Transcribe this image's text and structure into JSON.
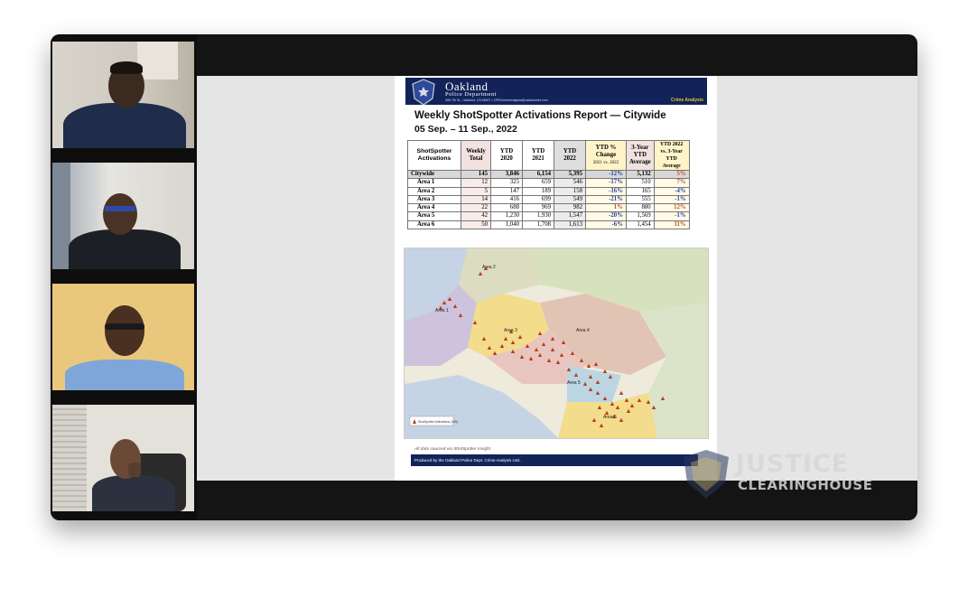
{
  "document": {
    "department_line1": "Oakland",
    "department_line2": "Police Department",
    "address": "455 7th St., Oakland, CA 94607 • OPDCrimeAnalysis@oaklandnet.com",
    "unit_tag": "Crime Analysis",
    "title": "Weekly ShotSpotter Activations Report — Citywide",
    "date_range": "05 Sep. – 11 Sep., 2022",
    "table": {
      "headers": [
        "ShotSpotter Activations",
        "Weekly Total",
        "YTD 2020",
        "YTD 2021",
        "YTD 2022",
        "YTD % Change",
        "3-Year YTD Average",
        "YTD 2022 vs. 3-Year YTD Average"
      ],
      "change_sub": "2021 vs. 2022",
      "rows": [
        {
          "label": "Citywide",
          "weekly": "145",
          "ytd2020": "3,846",
          "ytd2021": "6,154",
          "ytd2022": "5,395",
          "change": "-12%",
          "avg": "5,132",
          "vs": "5%"
        },
        {
          "label": "Area 1",
          "weekly": "12",
          "ytd2020": "325",
          "ytd2021": "659",
          "ytd2022": "546",
          "change": "-17%",
          "avg": "510",
          "vs": "7%"
        },
        {
          "label": "Area 2",
          "weekly": "5",
          "ytd2020": "147",
          "ytd2021": "189",
          "ytd2022": "158",
          "change": "-16%",
          "avg": "165",
          "vs": "-4%"
        },
        {
          "label": "Area 3",
          "weekly": "14",
          "ytd2020": "416",
          "ytd2021": "699",
          "ytd2022": "549",
          "change": "-21%",
          "avg": "555",
          "vs": "-1%"
        },
        {
          "label": "Area 4",
          "weekly": "22",
          "ytd2020": "688",
          "ytd2021": "969",
          "ytd2022": "982",
          "change": "1%",
          "avg": "880",
          "vs": "12%"
        },
        {
          "label": "Area 5",
          "weekly": "42",
          "ytd2020": "1,230",
          "ytd2021": "1,930",
          "ytd2022": "1,547",
          "change": "-20%",
          "avg": "1,569",
          "vs": "-1%"
        },
        {
          "label": "Area 6",
          "weekly": "50",
          "ytd2020": "1,040",
          "ytd2021": "1,708",
          "ytd2022": "1,613",
          "change": "-6%",
          "avg": "1,454",
          "vs": "11%"
        }
      ]
    },
    "map": {
      "area_labels": [
        "Area 1",
        "Area 2",
        "Area 3",
        "Area 4",
        "Area 5",
        "Area 6"
      ],
      "legend": "ShotSpotter Activations (145)"
    },
    "source_note": "All data sourced via ShotSpotter Insight",
    "footer": "Produced by the Oakland Police Dept. Crime Analysis Unit."
  },
  "watermark": {
    "line1": "JUSTICE",
    "line2": "CLEARINGHOUSE"
  },
  "colors": {
    "navy": "#12235a",
    "negative": "#2a3ea8",
    "positive": "#c0502a",
    "marker": "#b5401f"
  },
  "participants": [
    {
      "icon": "participant-1-video"
    },
    {
      "icon": "participant-2-video"
    },
    {
      "icon": "participant-3-video"
    },
    {
      "icon": "participant-4-video"
    }
  ]
}
